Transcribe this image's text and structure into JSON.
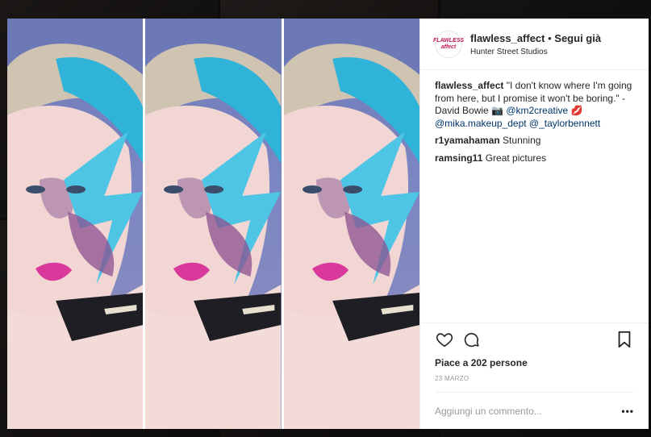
{
  "post": {
    "username": "flawless_affect",
    "separator": " • ",
    "follow_label": "Segui già",
    "location": "Hunter Street Studios",
    "avatar_text": "FLAWLESS affect"
  },
  "comments": [
    {
      "user": "flawless_affect",
      "text_parts": [
        {
          "t": " \"I don't know where I'm going from here, but I promise it won't be boring.\" - David Bowie ",
          "m": false
        },
        {
          "t": "📷",
          "m": false
        },
        {
          "t": " @km2creative",
          "m": true
        },
        {
          "t": " 💋 ",
          "m": false
        },
        {
          "t": "@mika.makeup_dept",
          "m": true
        },
        {
          "t": " ",
          "m": false
        },
        {
          "t": "@_taylorbennett",
          "m": true
        }
      ]
    },
    {
      "user": "r1yamahaman",
      "text_parts": [
        {
          "t": " Stunning",
          "m": false
        }
      ]
    },
    {
      "user": "ramsing11",
      "text_parts": [
        {
          "t": " Great pictures",
          "m": false
        }
      ]
    }
  ],
  "actions": {
    "likes": "Piace a 202 persone",
    "date": "23 MARZO",
    "comment_placeholder": "Aggiungi un commento...",
    "more": "•••"
  },
  "icons": [
    "heart-icon",
    "comment-icon",
    "bookmark-icon",
    "more-options-icon"
  ]
}
